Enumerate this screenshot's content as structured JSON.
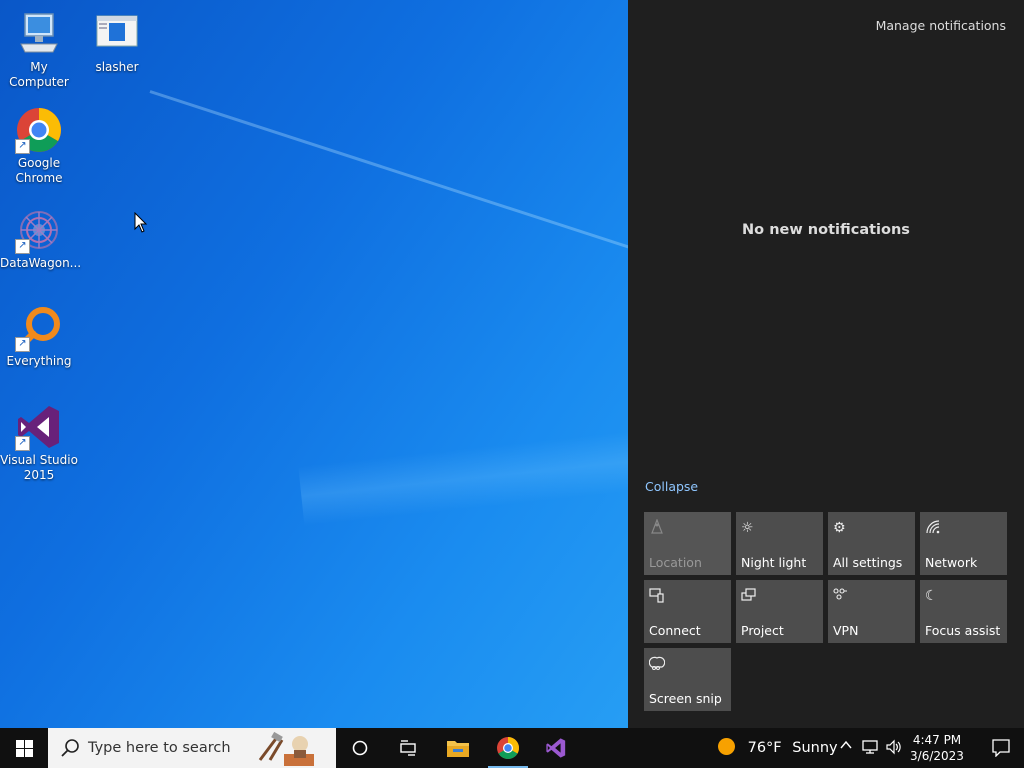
{
  "desktop": {
    "icons": [
      {
        "label": "My Computer",
        "icon": "computer-icon"
      },
      {
        "label": "slasher",
        "icon": "window-app-icon"
      },
      {
        "label": "Google Chrome",
        "icon": "chrome-icon"
      },
      {
        "label": "DataWagon...",
        "icon": "datawagon-icon"
      },
      {
        "label": "Everything",
        "icon": "everything-search-icon"
      },
      {
        "label": "Visual Studio 2015",
        "icon": "visual-studio-icon"
      }
    ]
  },
  "action_center": {
    "manage_label": "Manage notifications",
    "empty_message": "No new notifications",
    "collapse_label": "Collapse",
    "tiles": [
      {
        "label": "Location",
        "icon": "location-icon",
        "enabled": false
      },
      {
        "label": "Night light",
        "icon": "brightness-icon",
        "enabled": true
      },
      {
        "label": "All settings",
        "icon": "gear-icon",
        "enabled": true
      },
      {
        "label": "Network",
        "icon": "network-icon",
        "enabled": true
      },
      {
        "label": "Connect",
        "icon": "connect-icon",
        "enabled": true
      },
      {
        "label": "Project",
        "icon": "project-icon",
        "enabled": true
      },
      {
        "label": "VPN",
        "icon": "vpn-icon",
        "enabled": true
      },
      {
        "label": "Focus assist",
        "icon": "moon-icon",
        "enabled": true
      },
      {
        "label": "Screen snip",
        "icon": "scissors-icon",
        "enabled": true
      }
    ]
  },
  "taskbar": {
    "search_placeholder": "Type here to search",
    "weather_temp": "76°F",
    "weather_text": "Sunny",
    "time": "4:47 PM",
    "date": "3/6/2023"
  },
  "colors": {
    "action_center_bg": "#1f1f1f",
    "tile_bg": "#4d4d4d",
    "accent_link": "#8fc6ff",
    "taskbar_bg": "#101010"
  }
}
